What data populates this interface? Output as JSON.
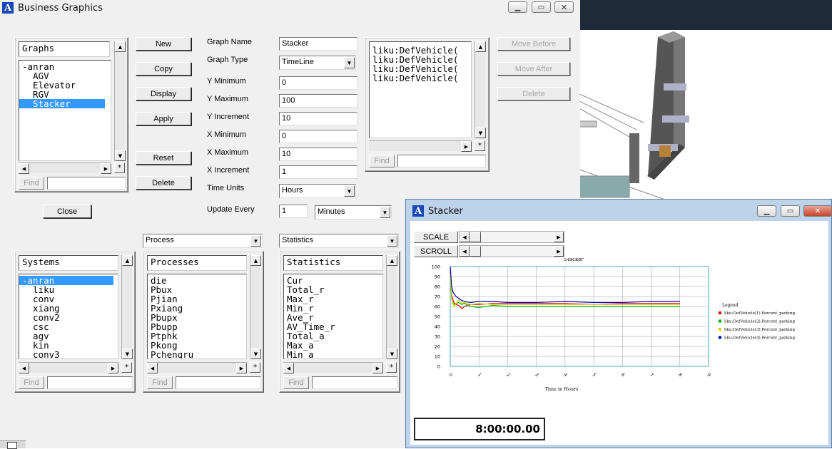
{
  "bg_window": {
    "colors": {
      "scene": "#1e2a3a"
    }
  },
  "bg": {
    "colors": {
      "scene": "#1e2a3a"
    }
  },
  "main_window": {
    "title": "Business Graphics",
    "buttons": {
      "new": "New",
      "copy": "Copy",
      "display": "Display",
      "apply": "Apply",
      "reset": "Reset",
      "delete": "Delete",
      "close": "Close"
    },
    "graphs_panel": {
      "header": "Graphs",
      "items": [
        "-anran",
        "  AGV",
        "  Elevator",
        "  RGV",
        "  Stacker"
      ],
      "find": "Find"
    },
    "form": {
      "graph_name_label": "Graph Name",
      "graph_name": "Stacker",
      "graph_type_label": "Graph Type",
      "graph_type": "TimeLine",
      "y_min_label": "Y Minimum",
      "y_min": "0",
      "y_max_label": "Y Maximum",
      "y_max": "100",
      "y_inc_label": "Y Increment",
      "y_inc": "10",
      "x_min_label": "X Minimum",
      "x_min": "0",
      "x_max_label": "X Maximum",
      "x_max": "10",
      "x_inc_label": "X Increment",
      "x_inc": "1",
      "time_units_label": "Time Units",
      "time_units": "Hours",
      "update_label": "Update Every",
      "update_value": "1",
      "update_unit": "Minutes"
    },
    "series_panel": {
      "items": [
        "liku:DefVehicle(",
        "liku:DefVehicle(",
        "liku:DefVehicle(",
        "liku:DefVehicle("
      ],
      "find": "Find"
    },
    "series_buttons": {
      "move_before": "Move Before",
      "move_after": "Move After",
      "delete": "Delete"
    },
    "dropdowns": {
      "process": "Process",
      "statistics": "Statistics"
    },
    "systems": {
      "header": "Systems",
      "items": [
        "-anran",
        "  liku",
        "  conv",
        "  xiang",
        "  conv2",
        "  csc",
        "  agv",
        "  kin",
        "  conv3"
      ],
      "find": "Find"
    },
    "processes": {
      "header": "Processes",
      "items": [
        "die",
        "Pbux",
        "Pjian",
        "Pxiang",
        "Pbupx",
        "Pbupp",
        "Ptphk",
        "Pkong",
        "Pchengru"
      ],
      "find": "Find"
    },
    "statistics": {
      "header": "Statistics",
      "items": [
        "Cur",
        "Total_r",
        "Max_r",
        "Min_r",
        "Ave_r",
        "AV_Time_r",
        "Total_a",
        "Max_a",
        "Min_a"
      ],
      "find": "Find"
    }
  },
  "graph_window": {
    "title": "Stacker",
    "scale_label": "SCALE",
    "scroll_label": "SCROLL",
    "clock": "8:00:00.00"
  },
  "chart_data": {
    "type": "line",
    "title": "Stacker",
    "xlabel": "Time in Hours",
    "ylabel": "",
    "xlim": [
      0,
      9
    ],
    "ylim": [
      0,
      100
    ],
    "x_ticks": [
      0,
      1,
      2,
      3,
      4,
      5,
      6,
      7,
      8,
      9
    ],
    "y_ticks": [
      0,
      10,
      20,
      30,
      40,
      50,
      60,
      70,
      80,
      90,
      100
    ],
    "legend_title": "Legend",
    "legend_position": "right",
    "grid": true,
    "series": [
      {
        "name": "liku:DefVehicle(1).Percent_parking",
        "color": "#dd0000",
        "x": [
          0,
          0.05,
          0.1,
          0.15,
          0.2,
          0.3,
          0.4,
          0.5,
          0.7,
          1,
          1.5,
          2,
          3,
          4,
          5,
          6,
          7,
          8
        ],
        "y": [
          95,
          72,
          66,
          63,
          62,
          61,
          58,
          60,
          62,
          62,
          63,
          63,
          63,
          63,
          62,
          63,
          63,
          63
        ]
      },
      {
        "name": "liku:DefVehicle(2).Percent_parking",
        "color": "#00b000",
        "x": [
          0,
          0.05,
          0.1,
          0.15,
          0.2,
          0.3,
          0.4,
          0.5,
          0.7,
          1,
          1.5,
          2,
          3,
          4,
          5,
          6,
          7,
          8
        ],
        "y": [
          90,
          68,
          63,
          62,
          63,
          64,
          62,
          63,
          60,
          59,
          61,
          60,
          60,
          60,
          60,
          60,
          60,
          60
        ]
      },
      {
        "name": "liku:DefVehicle(3).Percent_parking",
        "color": "#d6d600",
        "x": [
          0,
          0.05,
          0.1,
          0.15,
          0.2,
          0.3,
          0.4,
          0.5,
          0.7,
          1,
          1.5,
          2,
          3,
          4,
          5,
          6,
          7,
          8
        ],
        "y": [
          93,
          70,
          62,
          60,
          63,
          67,
          63,
          64,
          62,
          63,
          62,
          62,
          62,
          62,
          62,
          62,
          62,
          62
        ]
      },
      {
        "name": "liku:DefVehicle(4).Percent_parking",
        "color": "#0000c0",
        "x": [
          0,
          0.05,
          0.1,
          0.15,
          0.2,
          0.3,
          0.4,
          0.5,
          0.7,
          1,
          1.5,
          2,
          3,
          4,
          5,
          6,
          7,
          8
        ],
        "y": [
          100,
          80,
          74,
          72,
          70,
          68,
          66,
          65,
          64,
          65,
          65,
          64,
          64,
          65,
          64,
          64,
          65,
          65
        ]
      }
    ]
  }
}
